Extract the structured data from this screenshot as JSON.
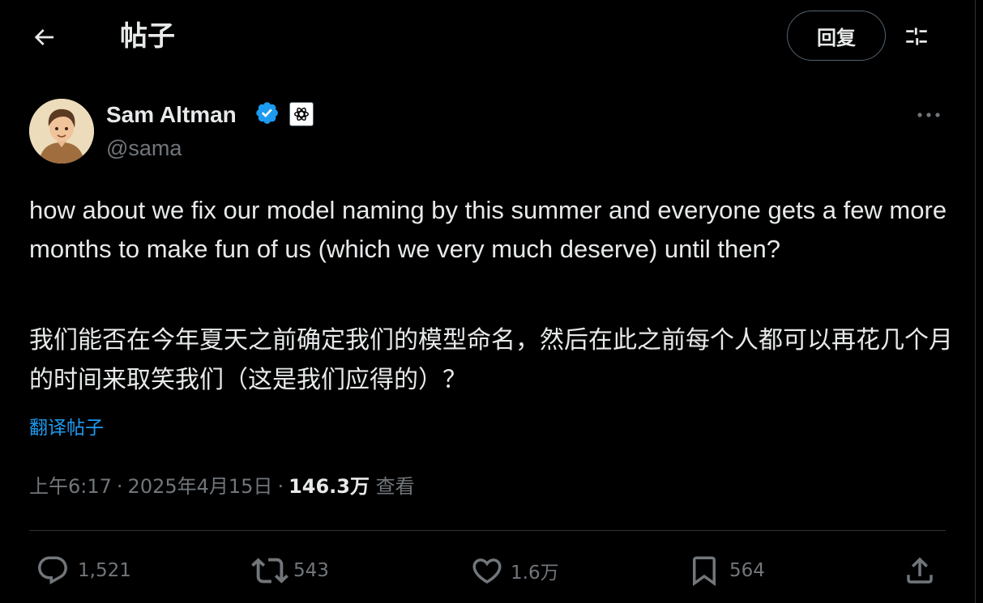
{
  "header": {
    "title": "帖子",
    "reply_label": "回复",
    "back_icon": "arrow-left-icon",
    "adjust_icon": "sliders-icon"
  },
  "author": {
    "name": "Sam Altman",
    "handle": "@sama",
    "verified_icon": "verified-badge-icon",
    "affiliate_icon": "openai-logo-icon"
  },
  "tweet": {
    "text_en": "how about we fix our model naming by this summer and everyone gets a few more months to make fun of us (which we very much deserve) until then?",
    "text_zh": "我们能否在今年夏天之前确定我们的模型命名，然后在此之前每个人都可以再花几个月的时间来取笑我们（这是我们应得的）？",
    "translate_label": "翻译帖子",
    "time": "上午6:17",
    "date": "2025年4月15日",
    "separator": "·",
    "views_count": "146.3万",
    "views_label": "查看"
  },
  "actions": {
    "replies": "1,521",
    "reposts": "543",
    "likes": "1.6万",
    "bookmarks": "564"
  },
  "colors": {
    "background": "#000000",
    "text": "#e7e9ea",
    "secondary": "#71767b",
    "accent": "#1d9bf0",
    "border": "#2f3336"
  }
}
